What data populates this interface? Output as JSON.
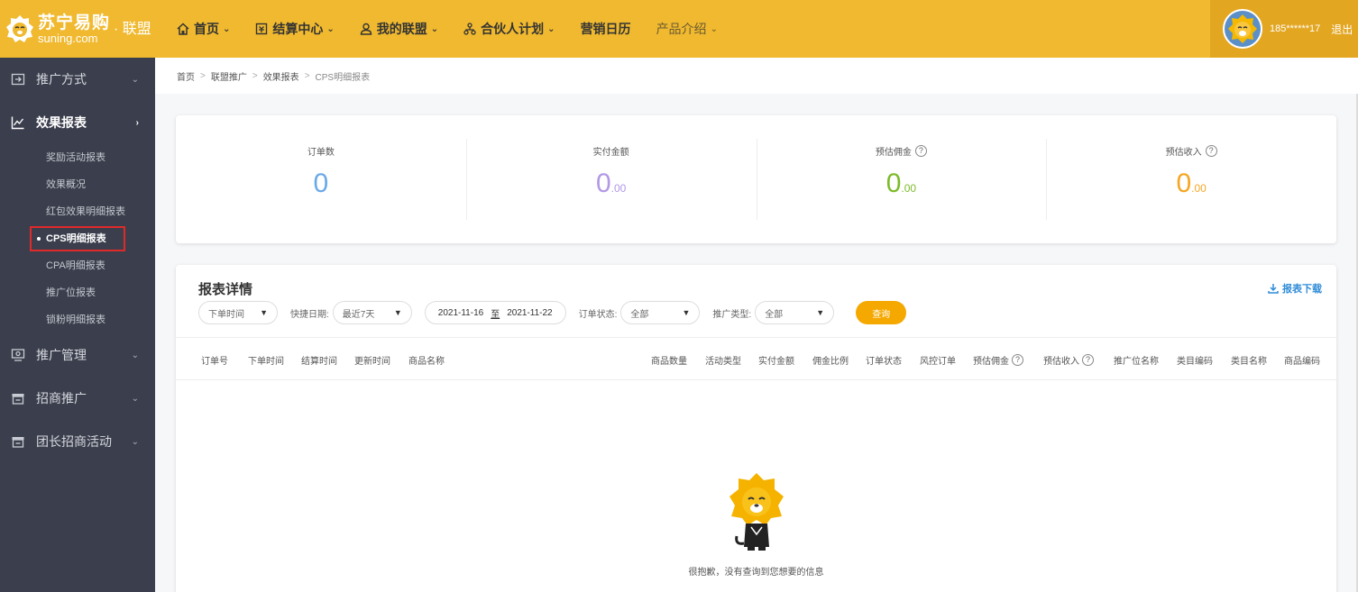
{
  "brand": {
    "name_cn": "苏宁易购",
    "name_en": "suning.com",
    "sub": "· 联盟"
  },
  "nav": [
    {
      "label": "首页",
      "icon": "home-icon",
      "chevron": true
    },
    {
      "label": "结算中心",
      "icon": "settlement-icon",
      "chevron": true
    },
    {
      "label": "我的联盟",
      "icon": "user-icon",
      "chevron": true
    },
    {
      "label": "合伙人计划",
      "icon": "partner-icon",
      "chevron": true
    },
    {
      "label": "营销日历",
      "icon": "",
      "chevron": false
    },
    {
      "label": "产品介绍",
      "icon": "",
      "chevron": true
    }
  ],
  "user": {
    "name": "185******17",
    "logout": "退出"
  },
  "sidebar": {
    "groups": [
      {
        "label": "推广方式",
        "icon": "promotion-icon"
      },
      {
        "label": "效果报表",
        "icon": "chart-line-icon"
      },
      {
        "label": "推广管理",
        "icon": "monitor-icon"
      },
      {
        "label": "招商推广",
        "icon": "store-icon"
      },
      {
        "label": "团长招商活动",
        "icon": "store-icon"
      }
    ],
    "sub_items": [
      "奖励活动报表",
      "效果概况",
      "红包效果明细报表",
      "CPS明细报表",
      "CPA明细报表",
      "推广位报表",
      "锁粉明细报表"
    ]
  },
  "breadcrumb": [
    "首页",
    "联盟推广",
    "效果报表",
    "CPS明细报表"
  ],
  "stats": [
    {
      "label": "订单数",
      "value": "0",
      "decimals": "",
      "color": "#6aa9e8",
      "help": false
    },
    {
      "label": "实付金额",
      "value": "0",
      "decimals": ".00",
      "color": "#b398e6",
      "help": false
    },
    {
      "label": "预估佣金",
      "value": "0",
      "decimals": ".00",
      "color": "#7cbb2a",
      "help": true
    },
    {
      "label": "预估收入",
      "value": "0",
      "decimals": ".00",
      "color": "#f5a623",
      "help": true
    }
  ],
  "report": {
    "title": "报表详情",
    "download": "报表下载",
    "filters": {
      "time_type": "下单时间",
      "quick_label": "快捷日期:",
      "quick_value": "最近7天",
      "date_from": "2021-11-16",
      "date_to_sep": "至",
      "date_to": "2021-11-22",
      "status_label": "订单状态:",
      "status_value": "全部",
      "type_label": "推广类型:",
      "type_value": "全部",
      "query": "查询"
    },
    "columns": [
      "订单号",
      "下单时间",
      "结算时间",
      "更新时间",
      "商品名称",
      "商品数量",
      "活动类型",
      "实付金额",
      "佣金比例",
      "订单状态",
      "风控订单",
      "预估佣金",
      "预估收入",
      "推广位名称",
      "类目编码",
      "类目名称",
      "商品编码"
    ],
    "empty_text": "很抱歉，没有查询到您想要的信息"
  },
  "colors": {
    "brand": "#f0b92f",
    "sidebar": "#3b3f4d",
    "accent": "#f5a800",
    "link": "#2f8cd8"
  }
}
